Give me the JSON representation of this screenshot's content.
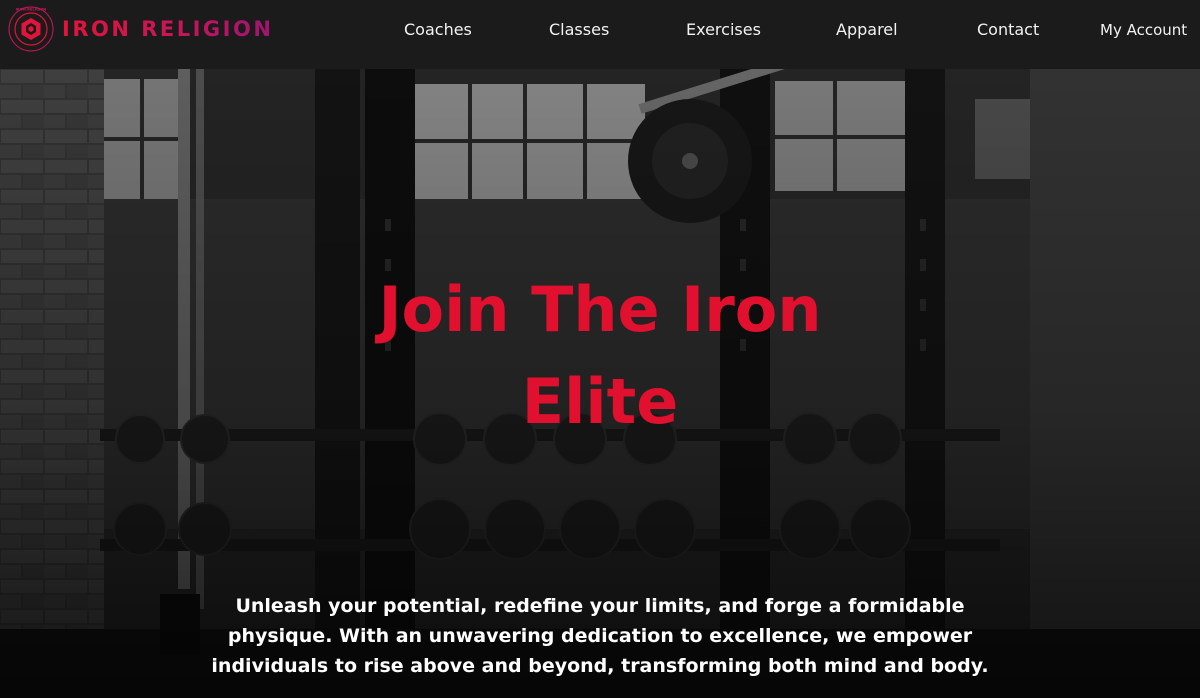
{
  "brand": {
    "name": "IRON RELIGION",
    "emblem_ring_text": "IRON RELIGION",
    "logo_icon": "hexagon-emblem-icon",
    "accent_color": "#e3143a",
    "gradient_end_color": "#9c1670"
  },
  "nav": {
    "items": [
      {
        "label": "Coaches"
      },
      {
        "label": "Classes"
      },
      {
        "label": "Exercises"
      },
      {
        "label": "Apparel"
      },
      {
        "label": "Contact"
      }
    ],
    "account_label": "My Account"
  },
  "hero": {
    "headline_line1": "Join The Iron",
    "headline_line2": "Elite",
    "headline_color": "#e0102e",
    "tagline": "Unleash your potential, redefine your limits, and forge a formidable physique. With an unwavering dedication to excellence, we empower individuals to rise above and beyond, transforming both mind and body."
  }
}
